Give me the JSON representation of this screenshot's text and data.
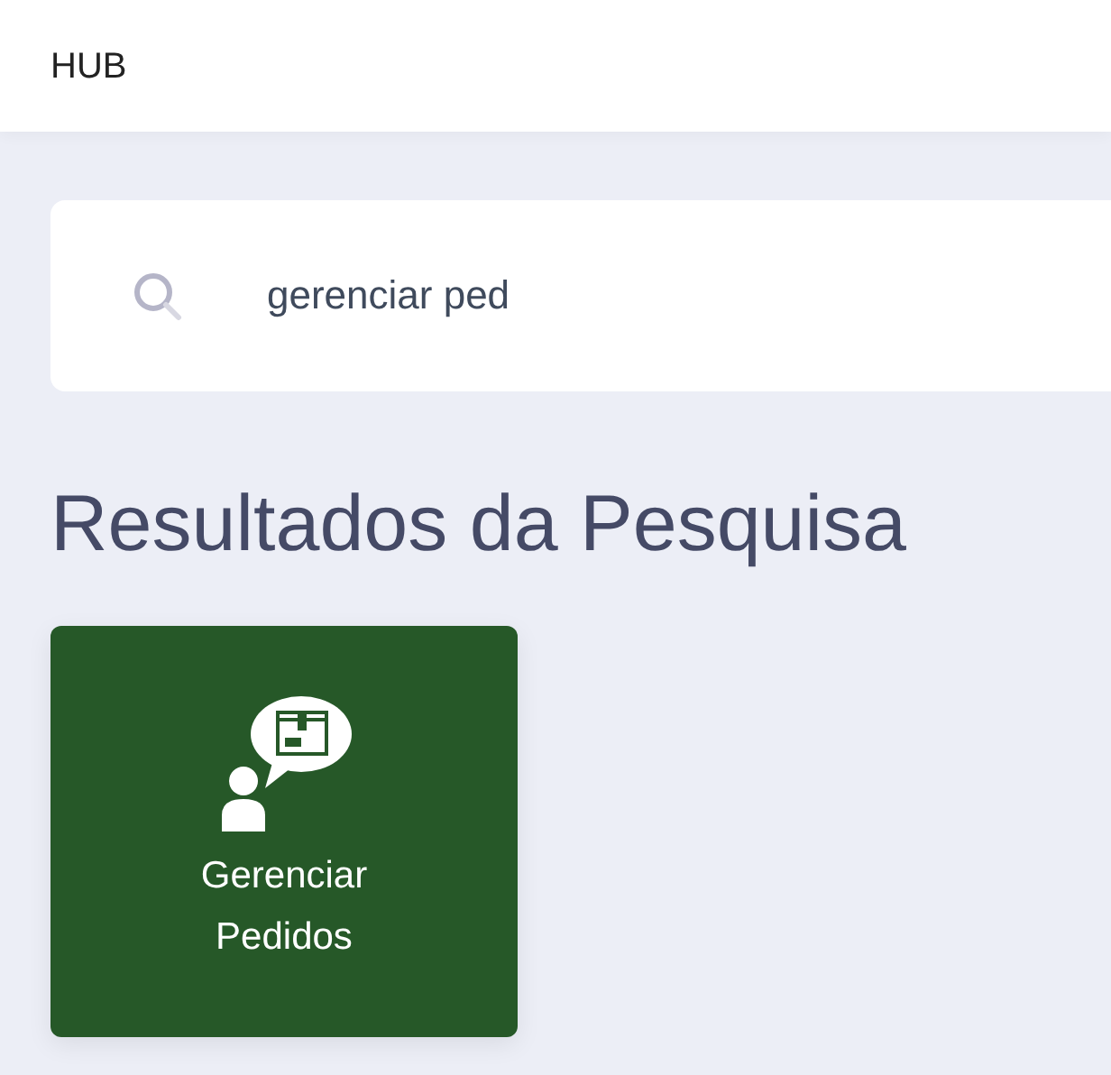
{
  "header": {
    "title": "HUB"
  },
  "search": {
    "value": "gerenciar ped"
  },
  "results": {
    "heading": "Resultados da Pesquisa",
    "items": [
      {
        "label": "Gerenciar Pedidos"
      }
    ]
  }
}
